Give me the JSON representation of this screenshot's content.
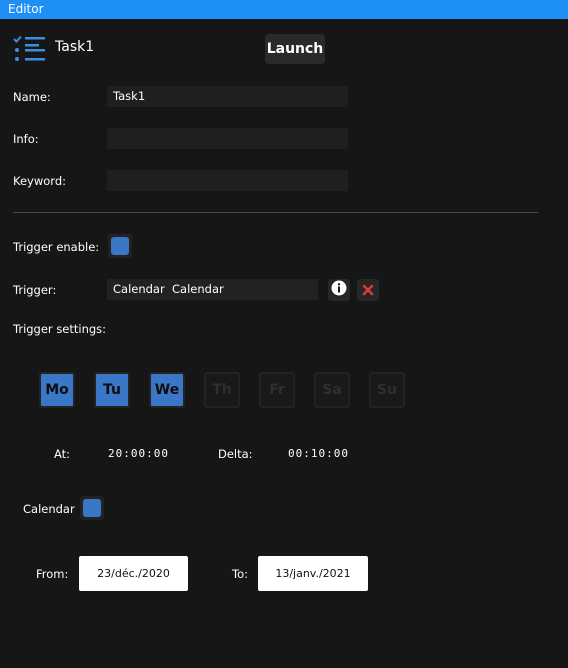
{
  "window": {
    "title": "Editor"
  },
  "header": {
    "task_name": "Task1",
    "launch_label": "Launch",
    "icon": "task-list-icon"
  },
  "fields": {
    "name": {
      "label": "Name:",
      "value": "Task1"
    },
    "info": {
      "label": "Info:",
      "value": ""
    },
    "keyword": {
      "label": "Keyword:",
      "value": ""
    }
  },
  "trigger": {
    "enable_label": "Trigger enable:",
    "enabled": true,
    "label": "Trigger:",
    "value": "Calendar  Calendar",
    "info_icon": "info-icon",
    "remove_icon": "close-icon",
    "settings_label": "Trigger settings:"
  },
  "days": [
    {
      "label": "Mo",
      "active": true
    },
    {
      "label": "Tu",
      "active": true
    },
    {
      "label": "We",
      "active": true
    },
    {
      "label": "Th",
      "active": false
    },
    {
      "label": "Fr",
      "active": false
    },
    {
      "label": "Sa",
      "active": false
    },
    {
      "label": "Su",
      "active": false
    }
  ],
  "timing": {
    "at_label": "At:",
    "at_value": "20:00:00",
    "delta_label": "Delta:",
    "delta_value": "00:10:00"
  },
  "calendar": {
    "label": "Calendar",
    "checked": true
  },
  "range": {
    "from_label": "From:",
    "from_value": "23/déc./2020",
    "to_label": "To:",
    "to_value": "13/janv./2021"
  },
  "colors": {
    "accent": "#1e90f5",
    "checkbox": "#3a77c6",
    "background": "#161616",
    "remove": "#e03a3a"
  }
}
